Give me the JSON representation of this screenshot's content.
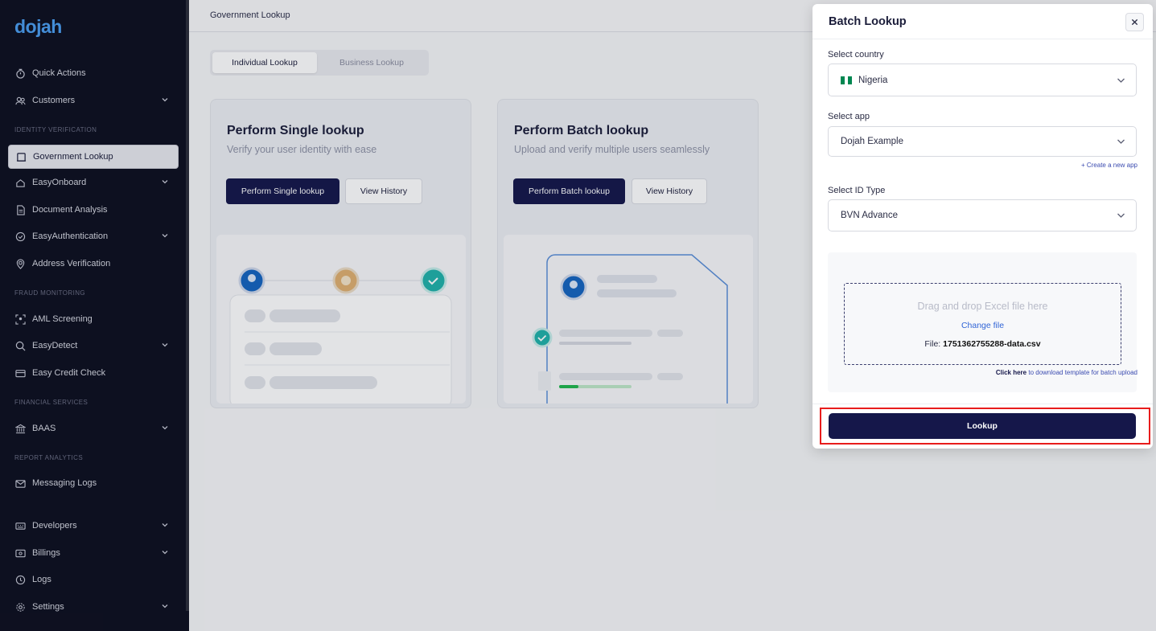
{
  "sidebar": {
    "logo": "dojah",
    "items": [
      {
        "label": "Quick Actions",
        "icon": "stopwatch-icon"
      },
      {
        "label": "Customers",
        "icon": "users-icon"
      },
      {
        "label": "Government Lookup",
        "icon": "id-card-icon"
      },
      {
        "label": "EasyOnboard",
        "icon": "onboard-icon"
      },
      {
        "label": "Document Analysis",
        "icon": "document-icon"
      },
      {
        "label": "EasyAuthentication",
        "icon": "check-badge-icon"
      },
      {
        "label": "Address Verification",
        "icon": "location-icon"
      },
      {
        "label": "AML Screening",
        "icon": "scan-face-icon"
      },
      {
        "label": "EasyDetect",
        "icon": "search-icon"
      },
      {
        "label": "Easy Credit Check",
        "icon": "credit-card-icon"
      },
      {
        "label": "BAAS",
        "icon": "bank-icon"
      },
      {
        "label": "Messaging Logs",
        "icon": "mail-icon"
      },
      {
        "label": "Developers",
        "icon": "dev-icon"
      },
      {
        "label": "Billings",
        "icon": "billing-icon"
      },
      {
        "label": "Logs",
        "icon": "logs-icon"
      },
      {
        "label": "Settings",
        "icon": "gear-icon"
      }
    ],
    "sections": {
      "identity": "IDENTITY VERIFICATION",
      "fraud": "FRAUD MONITORING",
      "financial": "FINANCIAL SERVICES",
      "report": "REPORT ANALYTICS"
    }
  },
  "header": {
    "title": "Government Lookup"
  },
  "tabs": [
    {
      "label": "Individual Lookup",
      "active": true
    },
    {
      "label": "Business Lookup",
      "active": false
    }
  ],
  "cards": {
    "single": {
      "title": "Perform Single lookup",
      "subtitle": "Verify your user identity with ease",
      "primary": "Perform Single lookup",
      "secondary": "View History"
    },
    "batch": {
      "title": "Perform Batch lookup",
      "subtitle": "Upload and verify multiple users seamlessly",
      "primary": "Perform Batch lookup",
      "secondary": "View History"
    }
  },
  "modal": {
    "title": "Batch Lookup",
    "country_label": "Select country",
    "country_value": "Nigeria",
    "app_label": "Select app",
    "app_value": "Dojah Example",
    "create_app": "+ Create a new app",
    "id_type_label": "Select ID Type",
    "id_type_value": "BVN Advance",
    "dropzone_text": "Drag and drop Excel file here",
    "change_file": "Change file",
    "file_prefix": "File:",
    "file_name": "1751362755288-data.csv",
    "template_link": "Click here",
    "template_text": "to download template for batch upload",
    "lookup_button": "Lookup"
  },
  "colors": {
    "sidebar_bg": "#0d0f1f",
    "primary": "#15174a",
    "accent_link": "#3064d6",
    "highlight": "#e81c1c",
    "nigeria_green": "#008751"
  }
}
